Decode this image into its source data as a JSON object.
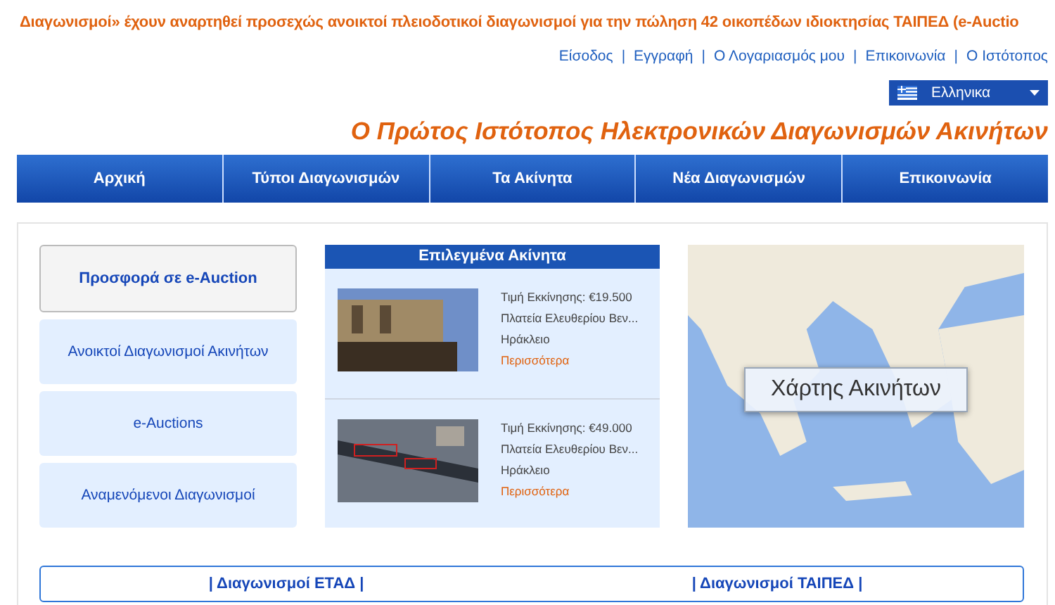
{
  "ticker": "Διαγωνισμοί» έχουν αναρτηθεί προσεχώς ανοικτοί πλειοδοτικοί διαγωνισμοί για την πώληση 42 οικοπέδων ιδιοκτησίας ΤΑΙΠΕΔ (e-Auctio",
  "top_links": [
    "Είσοδος",
    "Εγγραφή",
    "Ο Λογαριασμός μου",
    "Επικοινωνία",
    "Ο Ιστότοπος"
  ],
  "top_separators": [
    "|",
    "|",
    "|",
    "|"
  ],
  "language": {
    "label": "Ελληνικα"
  },
  "slogan": "Ο Πρώτος Ιστότοπος Ηλεκτρονικών Διαγωνισμών Ακινήτων",
  "nav": [
    "Αρχική",
    "Τύποι Διαγωνισμών",
    "Τα Ακίνητα",
    "Νέα Διαγωνισμών",
    "Επικοινωνία"
  ],
  "side_menu": [
    {
      "label": "Προσφορά σε e-Auction",
      "selected": true
    },
    {
      "label": "Ανοικτοί Διαγωνισμοί Ακινήτων",
      "selected": false
    },
    {
      "label": "e-Auctions",
      "selected": false
    },
    {
      "label": "Αναμενόμενοι Διαγωνισμοί",
      "selected": false
    }
  ],
  "featured": {
    "title": "Επιλεγμένα Ακίνητα",
    "items": [
      {
        "kind": "building",
        "price": "Τιμή Εκκίνησης: €19.500",
        "address": "Πλατεία Ελευθερίου Βεν...",
        "city": "Ηράκλειο",
        "more": "Περισσότερα"
      },
      {
        "kind": "aerial",
        "price": "Τιμή Εκκίνησης: €49.000",
        "address": "Πλατεία Ελευθερίου Βεν...",
        "city": "Ηράκλειο",
        "more": "Περισσότερα"
      }
    ]
  },
  "map": {
    "label": "Χάρτης Ακινήτων"
  },
  "bottom_links": [
    "| Διαγωνισμοί ΕΤΑΔ |",
    "| Διαγωνισμοί ΤΑΙΠΕΔ |"
  ]
}
